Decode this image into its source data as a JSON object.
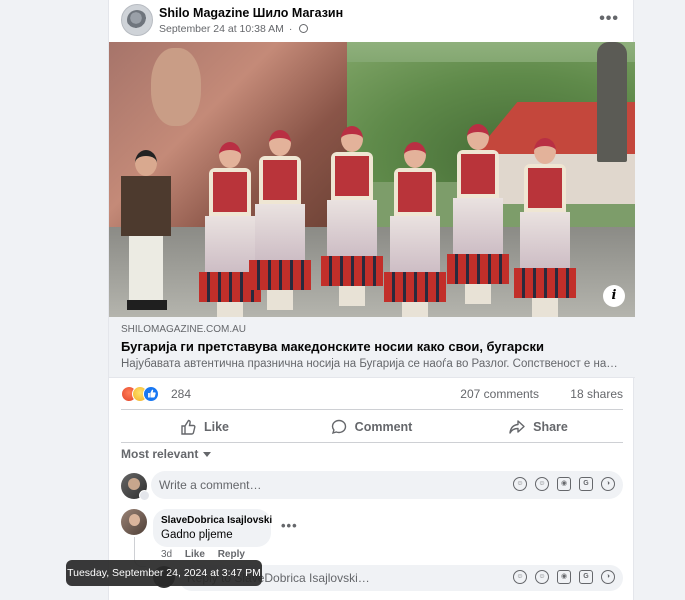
{
  "post": {
    "page_name": "Shilo Magazine Шило Магазин",
    "timestamp": "September 24 at 10:38 AM",
    "audience_icon": "globe-icon",
    "more_icon": "more-icon",
    "more_label": "•••"
  },
  "link_preview": {
    "domain": "SHILOMAGAZINE.COM.AU",
    "title": "Бугарија ги претставува македонските носии како свои, бугарски",
    "description": "Најубавата автентична празнична носија на Бугарија се наоѓа во Разлог. Сопственост е на…",
    "info_label": "i"
  },
  "stats": {
    "reaction_icons": [
      "angry-reaction",
      "haha-reaction",
      "like-reaction"
    ],
    "reaction_count": "284",
    "comments": "207 comments",
    "shares": "18 shares"
  },
  "actions": {
    "like": "Like",
    "comment": "Comment",
    "share": "Share"
  },
  "comments_section": {
    "sort_label": "Most relevant",
    "compose_placeholder": "Write a comment…",
    "tool_icons": [
      "avatar-sticker-icon",
      "emoji-icon",
      "camera-icon",
      "gif-icon",
      "sticker-icon"
    ],
    "items": [
      {
        "author": "SlaveDobrica Isajlovski",
        "text": "Gadno pljeme",
        "age": "3d",
        "like": "Like",
        "reply": "Reply",
        "more": "•••"
      }
    ],
    "reply_placeholder": "Reply to SlaveDobrica Isajlovski…"
  },
  "tooltip": {
    "text": "Tuesday, September 24, 2024 at 3:47 PM"
  },
  "colors": {
    "accent": "#1877f2",
    "secondary_text": "#65676b",
    "surface": "#f0f2f5"
  }
}
